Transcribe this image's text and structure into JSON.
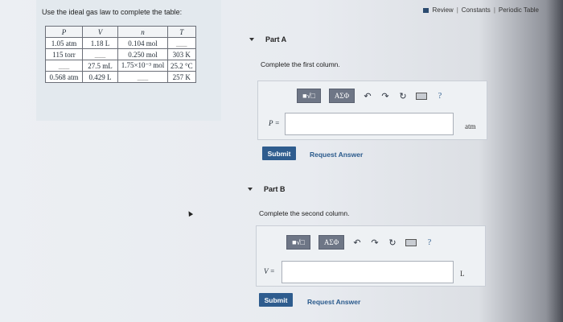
{
  "prompt": "Use the ideal gas law to complete the table:",
  "topbar": {
    "review": "Review",
    "sep1": "|",
    "constants": "Constants",
    "sep2": "|",
    "periodic": "Periodic Table"
  },
  "table": {
    "headers": [
      "P",
      "V",
      "n",
      "T"
    ],
    "rows": [
      [
        "1.05 atm",
        "1.18 L",
        "0.104 mol",
        "___"
      ],
      [
        "115 torr",
        "___",
        "0.250 mol",
        "303 K"
      ],
      [
        "___",
        "27.5 mL",
        "1.75×10⁻³ mol",
        "25.2 °C"
      ],
      [
        "0.568 atm",
        "0.429 L",
        "___",
        "257 K"
      ]
    ]
  },
  "partA": {
    "title": "Part A",
    "instruction": "Complete the first column.",
    "var_label": "P =",
    "unit": "atm",
    "toolbar": {
      "sqrt_label": "■√□",
      "greek_label": "ΑΣΦ",
      "undo": "↶",
      "redo": "↷",
      "reset": "↻",
      "help": "?"
    },
    "submit": "Submit",
    "request": "Request Answer"
  },
  "partB": {
    "title": "Part B",
    "instruction": "Complete the second column.",
    "var_label": "V =",
    "unit": "L",
    "toolbar": {
      "sqrt_label": "■√□",
      "greek_label": "ΑΣΦ",
      "undo": "↶",
      "redo": "↷",
      "reset": "↻",
      "help": "?"
    },
    "submit": "Submit",
    "request": "Request Answer"
  }
}
